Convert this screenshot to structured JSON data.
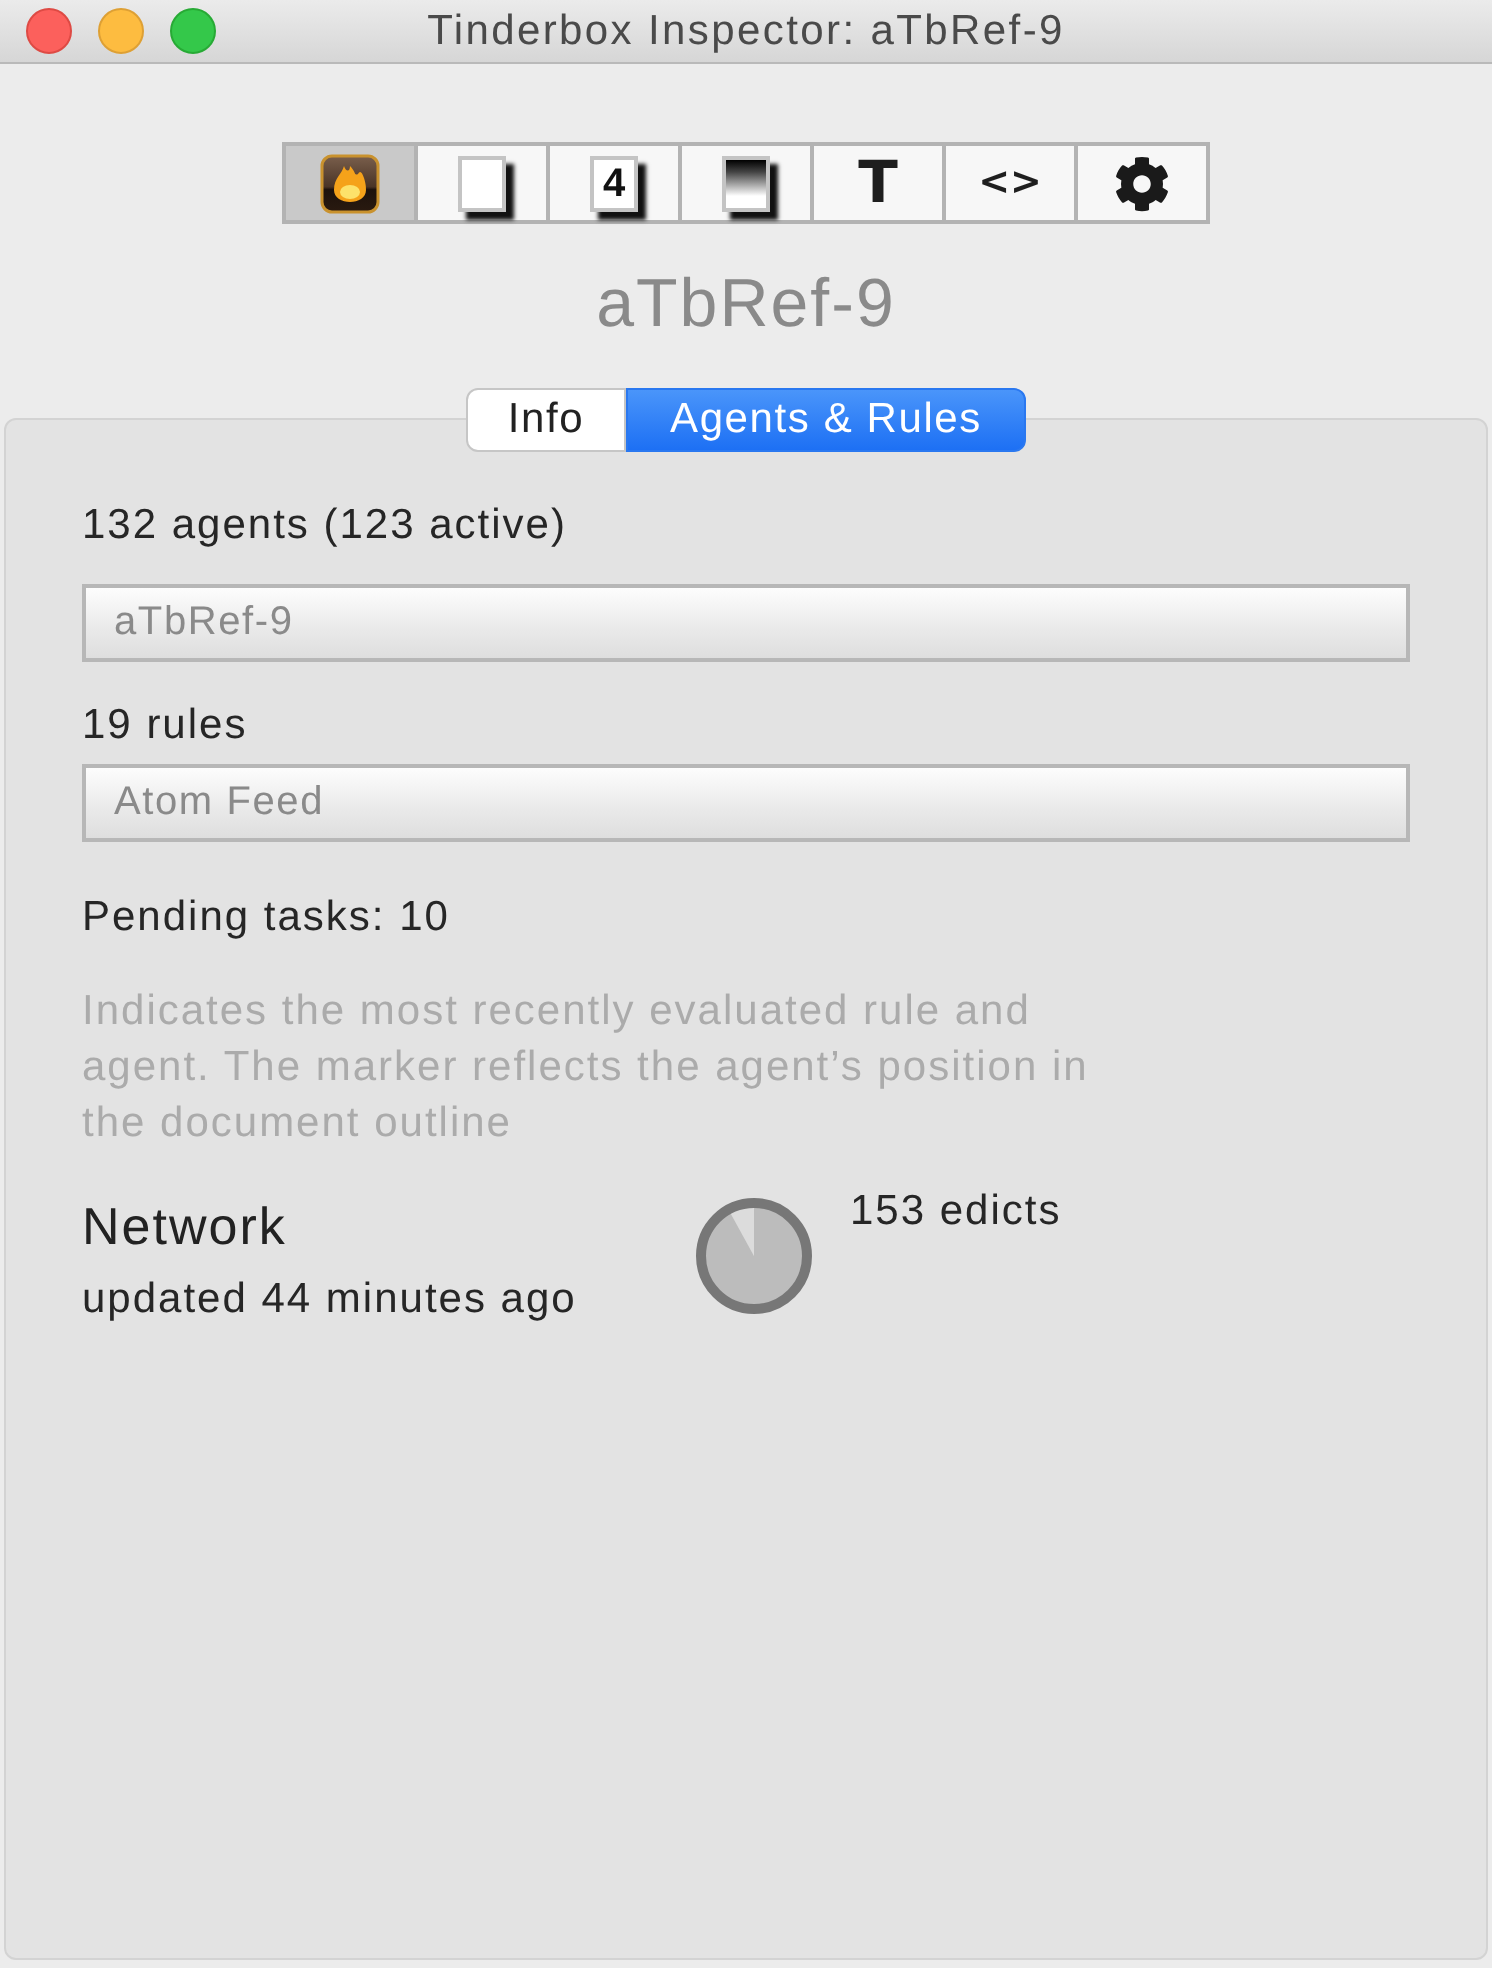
{
  "window": {
    "title": "Tinderbox Inspector: aTbRef-9"
  },
  "toolbar": [
    {
      "kind": "app",
      "selected": true
    },
    {
      "kind": "note",
      "selected": false
    },
    {
      "kind": "note",
      "glyph": "4",
      "selected": false
    },
    {
      "kind": "shade",
      "selected": false
    },
    {
      "kind": "glyph",
      "glyph": "T",
      "selected": false
    },
    {
      "kind": "glyph",
      "glyph": "<>",
      "selected": false
    },
    {
      "kind": "gear",
      "selected": false
    }
  ],
  "document_title": "aTbRef-9",
  "tabs": [
    {
      "label": "Info",
      "selected": false
    },
    {
      "label": "Agents & Rules",
      "selected": true
    }
  ],
  "agents": {
    "summary": "132 agents (123 active)",
    "field_value": "aTbRef-9"
  },
  "rules": {
    "summary": "19 rules",
    "field_value": "Atom Feed"
  },
  "pending": "Pending tasks: 10",
  "description": "Indicates the most recently evaluated rule and agent. The marker reflects the agent’s position in the document outline",
  "network": {
    "title": "Network",
    "updated": "updated 44 minutes ago",
    "progress": {
      "level": 0.92
    },
    "edicts": "153 edicts"
  }
}
